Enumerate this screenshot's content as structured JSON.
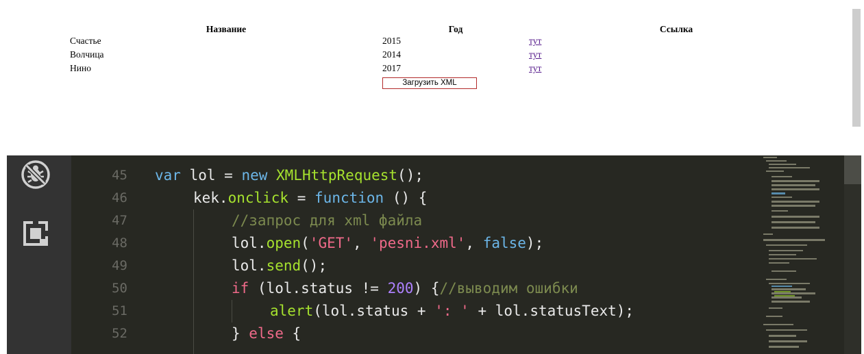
{
  "page": {
    "table": {
      "headers": [
        "Название",
        "Год",
        "Ссылка"
      ],
      "rows": [
        {
          "name": "Счастье",
          "year": "2015",
          "link": "тут"
        },
        {
          "name": "Волчица",
          "year": "2014",
          "link": "тут"
        },
        {
          "name": "Нино",
          "year": "2017",
          "link": "тут"
        }
      ]
    },
    "load_button_label": "Загрузить XML"
  },
  "editor": {
    "line_numbers": [
      "45",
      "46",
      "47",
      "48",
      "49",
      "50",
      "51",
      "52"
    ],
    "lines": {
      "l45": {
        "var": "var",
        "name": " lol = ",
        "new": "new",
        "cls": " XMLHttpRequest",
        "end": "();"
      },
      "l46": {
        "obj": "kek.",
        "prop": "onclick",
        "eq": " = ",
        "fn": "function",
        "end": " () {"
      },
      "l47": {
        "comment": "//запрос для xml файла"
      },
      "l48": {
        "pre": "lol.",
        "method": "open",
        "open": "(",
        "s1": "'GET'",
        "comma1": ", ",
        "s2": "'pesni.xml'",
        "comma2": ", ",
        "bool": "false",
        "end": ");"
      },
      "l49": {
        "pre": "lol.",
        "method": "send",
        "end": "();"
      },
      "l50": {
        "if": "if",
        "pre": " (lol.status != ",
        "num": "200",
        "mid": ") {",
        "comment": "//выводим ошибки"
      },
      "l51": {
        "fn": "alert",
        "pre": "(lol.status + ",
        "str": "': '",
        "end": " + lol.statusText);"
      },
      "l52": {
        "pre": "} ",
        "else": "else",
        "end": " {"
      }
    },
    "icons": [
      "no-debug-icon",
      "extensions-icon"
    ],
    "colors": {
      "background": "#272822",
      "keyword": "#6cb6e8",
      "function": "#a6e22e",
      "string": "#f06a8a",
      "number": "#ae81ff",
      "comment": "#7c8a4f"
    }
  }
}
